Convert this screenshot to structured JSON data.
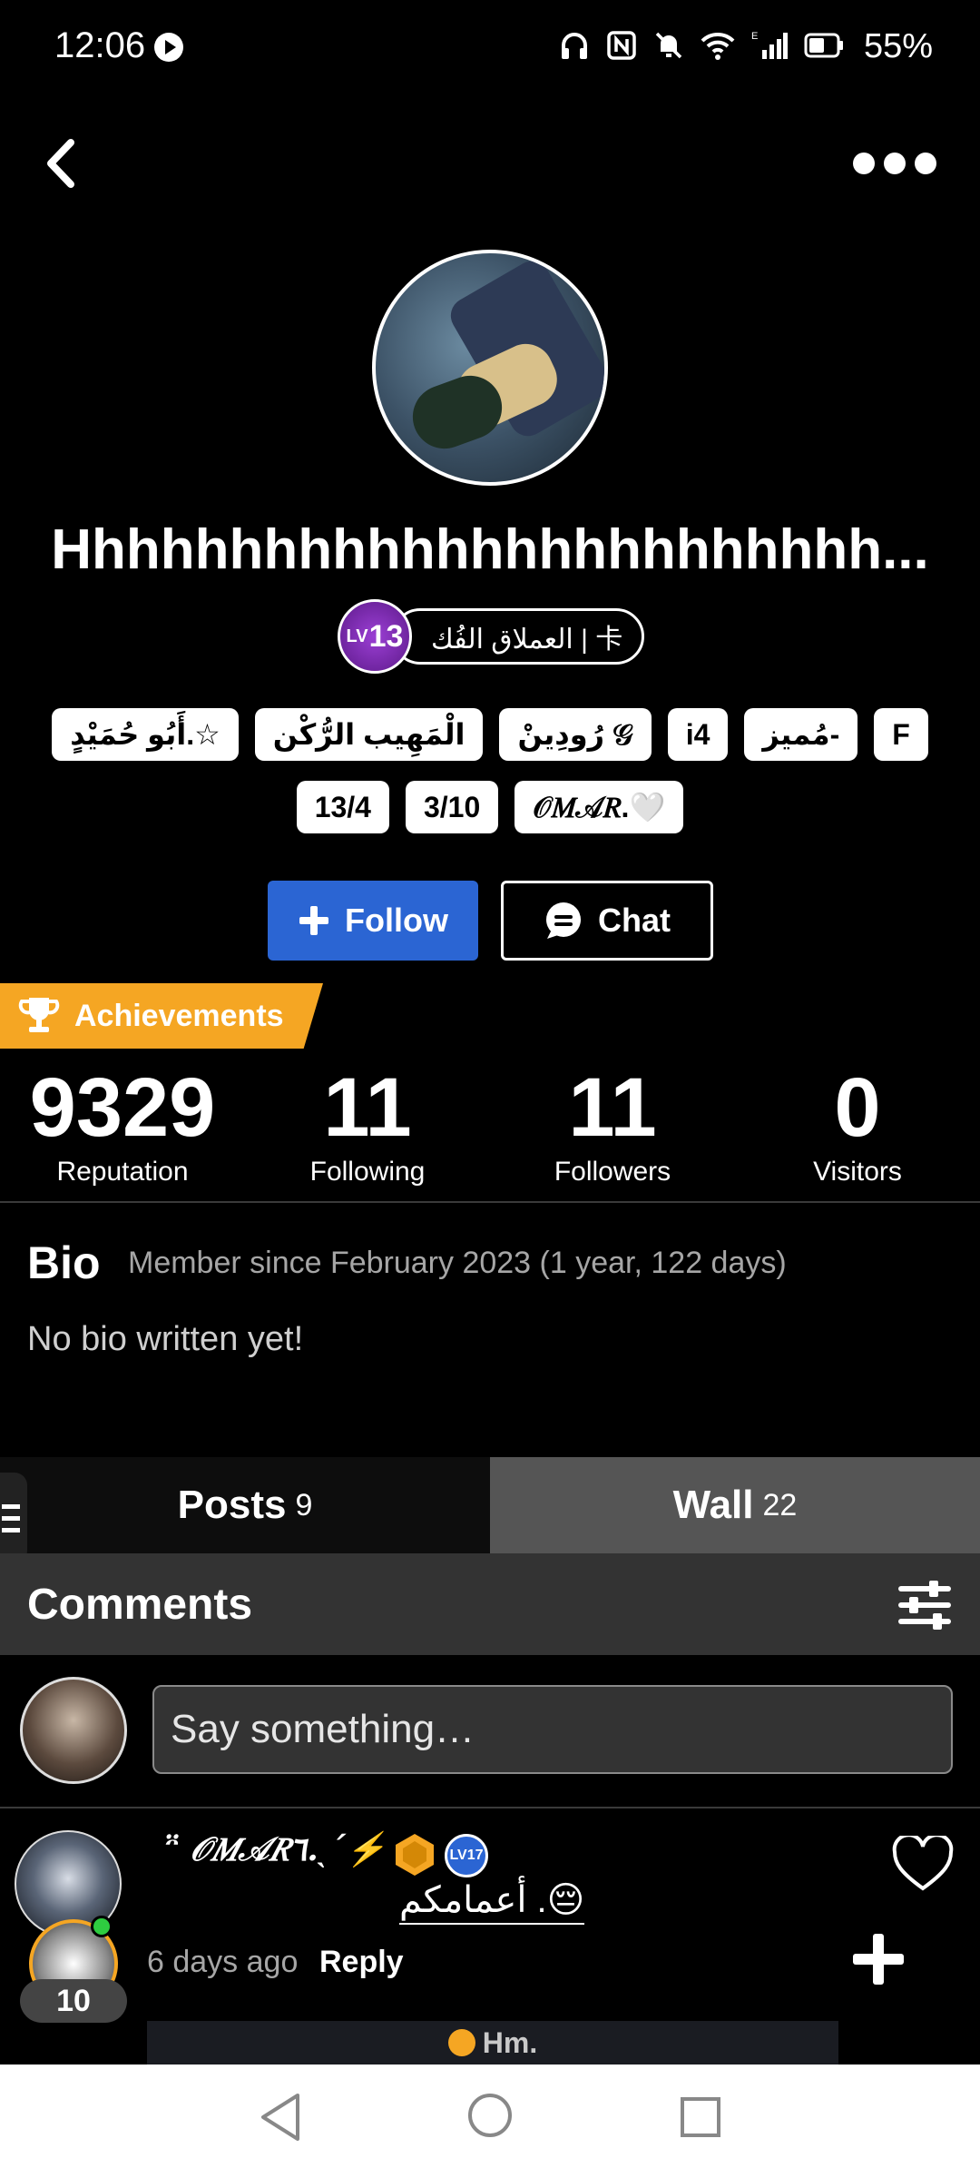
{
  "status_bar": {
    "time": "12:06",
    "battery": "55%",
    "network": "E"
  },
  "profile": {
    "name": "Hhhhhhhhhhhhhhhhhhhhhhhh...",
    "level": "13",
    "level_prefix": "LV",
    "title": "العملاق الفُك | 卡",
    "tags_row1": [
      "أَبُو حُمَيْدٍ.☆",
      "الْمَهِيب الرُّكْن",
      "رُودِينْ 𝒢",
      "i4",
      "مُميز-",
      "F"
    ],
    "tags_row2": [
      "13/4",
      "3/10",
      "𝒪𝑀𝒜𝑅.🤍"
    ]
  },
  "actions": {
    "follow_label": "Follow",
    "chat_label": "Chat"
  },
  "achievements_label": "Achievements",
  "stats": [
    {
      "value": "9329",
      "label": "Reputation"
    },
    {
      "value": "11",
      "label": "Following"
    },
    {
      "value": "11",
      "label": "Followers"
    },
    {
      "value": "0",
      "label": "Visitors"
    }
  ],
  "bio": {
    "heading": "Bio",
    "member_since": "Member since February 2023 (1 year, 122 days)",
    "text": "No bio written yet!"
  },
  "tabs": [
    {
      "label": "Posts",
      "count": "9"
    },
    {
      "label": "Wall",
      "count": "22"
    }
  ],
  "comments": {
    "title": "Comments",
    "placeholder": "Say something…",
    "items": [
      {
        "author": "ᵔ̈ 𝒪𝑀𝒜𝑅٦.ˎˊ⚡",
        "author_level": "LV17",
        "commenter_level": "10",
        "text": "أعمامكم .😔",
        "time": "6 days ago",
        "reply_label": "Reply",
        "preview_text": "Hm."
      }
    ]
  },
  "colors": {
    "follow_blue": "#2b65d3",
    "achievements_orange": "#f5a623",
    "level_purple": "#9b3fd4"
  }
}
